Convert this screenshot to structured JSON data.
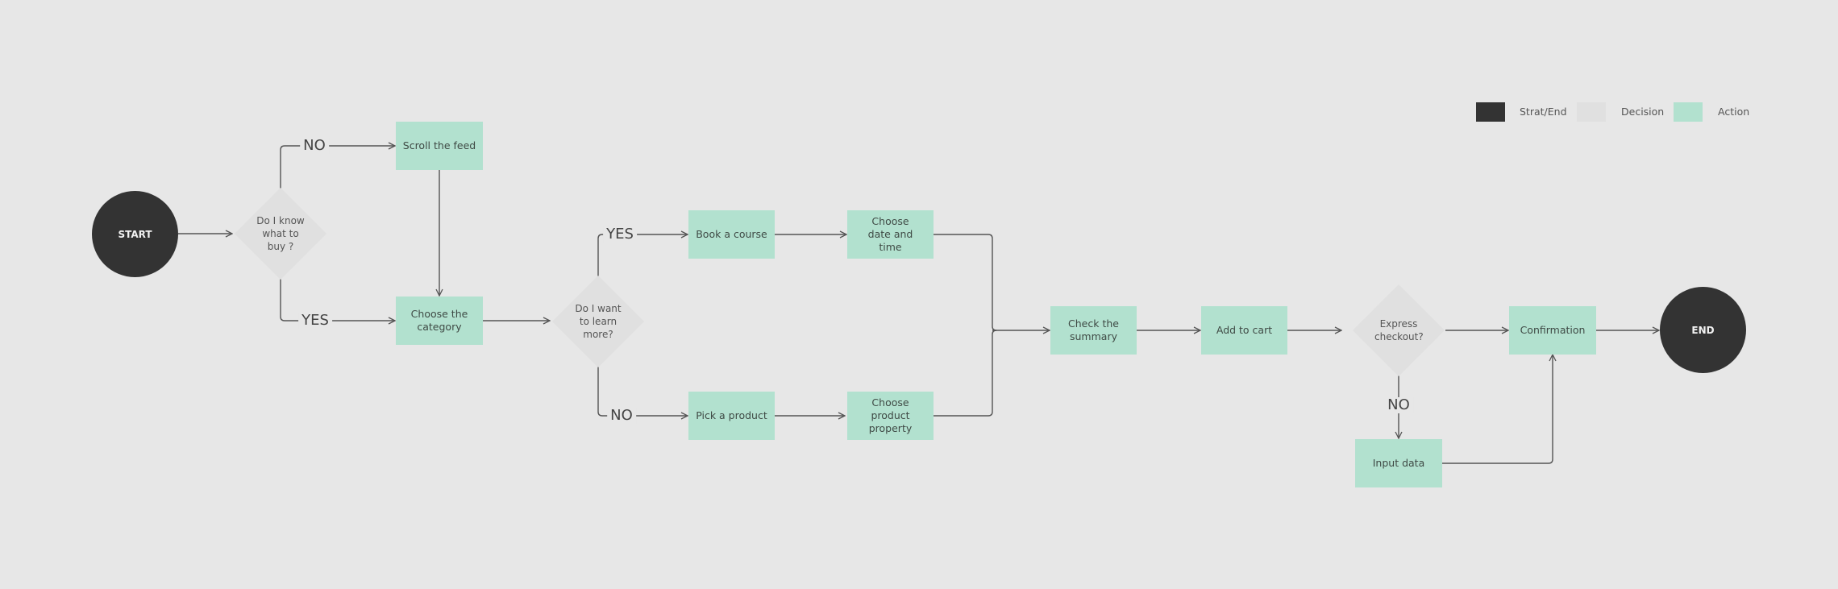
{
  "legend": {
    "items": [
      {
        "label": "Strat/End",
        "color": "#333333"
      },
      {
        "label": "Decision",
        "color": "#e0e0e0"
      },
      {
        "label": "Action",
        "color": "#b2e1cf"
      }
    ]
  },
  "nodes": {
    "start": "START",
    "decision_buy": "Do I know what to buy ?",
    "scroll_feed": "Scroll the feed",
    "choose_category": "Choose the category",
    "decision_learn": "Do I want to learn more?",
    "book_course": "Book a course",
    "choose_date": "Choose date and time",
    "pick_product": "Pick a product",
    "choose_property": "Choose product property",
    "check_summary": "Check the summary",
    "add_to_cart": "Add to cart",
    "decision_express": "Express checkout?",
    "confirmation": "Confirmation",
    "input_data": "Input data",
    "end": "END"
  },
  "branches": {
    "buy_no": "NO",
    "buy_yes": "YES",
    "learn_yes": "YES",
    "learn_no": "NO",
    "express_no": "NO"
  },
  "colors": {
    "background": "#e7e7e7",
    "connector": "#555555"
  }
}
